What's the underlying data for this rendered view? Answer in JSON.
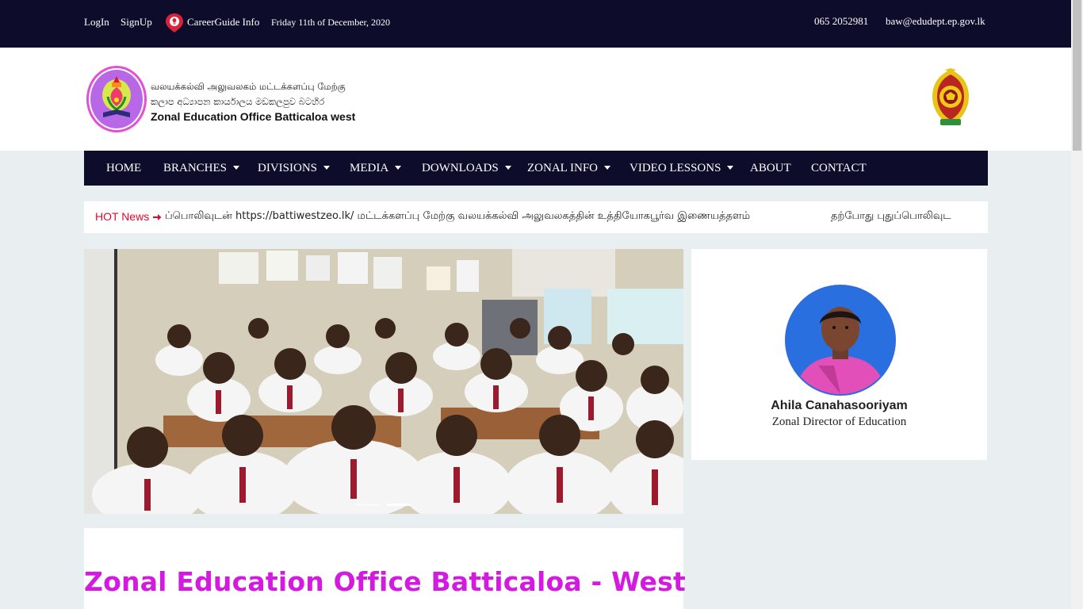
{
  "topbar": {
    "login": "LogIn",
    "signup": "SignUp",
    "careerguide": "CareerGuide Info",
    "date": "Friday 11th of December, 2020",
    "phone": "065 2052981",
    "email": "baw@edudept.ep.gov.lk"
  },
  "header": {
    "logo_line1": "வலயக்கல்வி அலுவலகம் மட்டக்களப்பு மேற்கு",
    "logo_line2": "කලාප අධ්‍යාපන කාර්යාලය මඩකලපුව බටහිර",
    "logo_line3": "Zonal Education Office Batticaloa west"
  },
  "nav": {
    "items": [
      {
        "label": "HOME",
        "dropdown": false
      },
      {
        "label": "BRANCHES",
        "dropdown": true
      },
      {
        "label": "DIVISIONS",
        "dropdown": true
      },
      {
        "label": "MEDIA",
        "dropdown": true
      },
      {
        "label": "DOWNLOADS",
        "dropdown": true
      },
      {
        "label": "ZONAL INFO",
        "dropdown": true
      },
      {
        "label": "VIDEO LESSONS",
        "dropdown": true
      },
      {
        "label": "ABOUT",
        "dropdown": false
      },
      {
        "label": "CONTACT",
        "dropdown": false
      }
    ]
  },
  "ticker": {
    "label": "HOT News",
    "text": "ப்பொலிவுடன் https://battiwestzeo.lk/ மட்டக்களப்பு மேற்கு வலயக்கல்வி அலுவலகத்தின் உத்தியோகபூர்வ இணையத்தளம்",
    "text2": "தற்போது புதுப்பொலிவுட"
  },
  "slider": {
    "active_index": 1,
    "count": 2
  },
  "director": {
    "name": "Ahila Canahasooriyam",
    "title": "Zonal Director of Education"
  },
  "welcome": {
    "heading": "Zonal Education Office Batticaloa - West"
  },
  "colors": {
    "navy": "#0d0d2b",
    "hot_red": "#e3082d",
    "heading_magenta": "#d41ae0",
    "page_bg": "#e9eff0"
  }
}
